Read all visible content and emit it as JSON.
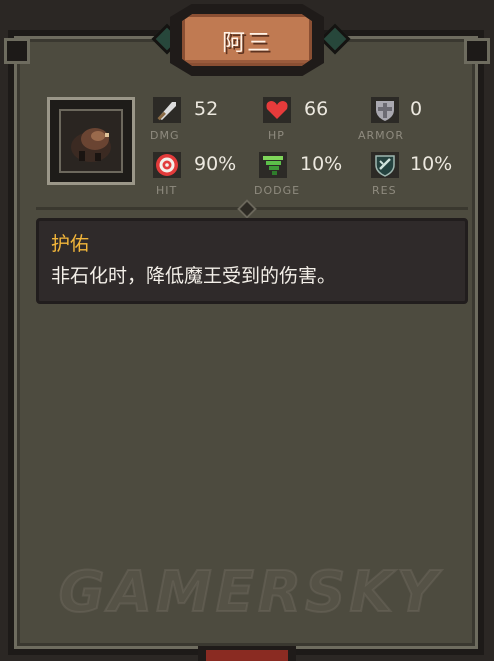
{
  "panel": {
    "title": "阿三"
  },
  "stats": {
    "dmg": {
      "value": "52",
      "label": "DMG",
      "icon": "sword-icon"
    },
    "hp": {
      "value": "66",
      "label": "HP",
      "icon": "heart-icon"
    },
    "armor": {
      "value": "0",
      "label": "ARMOR",
      "icon": "shield-icon"
    },
    "hit": {
      "value": "90%",
      "label": "HIT",
      "icon": "target-icon"
    },
    "dodge": {
      "value": "10%",
      "label": "DODGE",
      "icon": "tornado-icon"
    },
    "res": {
      "value": "10%",
      "label": "RES",
      "icon": "res-shield-icon"
    }
  },
  "skill": {
    "name": "护佑",
    "description": "非石化时，降低魔王受到的伤害。"
  },
  "watermark": "GAMERSKY",
  "colors": {
    "panel_bg": "#504e42",
    "title_plate": "#c07a52",
    "skill_name": "#f3b63a",
    "desc_bg": "#2f2a2a"
  }
}
